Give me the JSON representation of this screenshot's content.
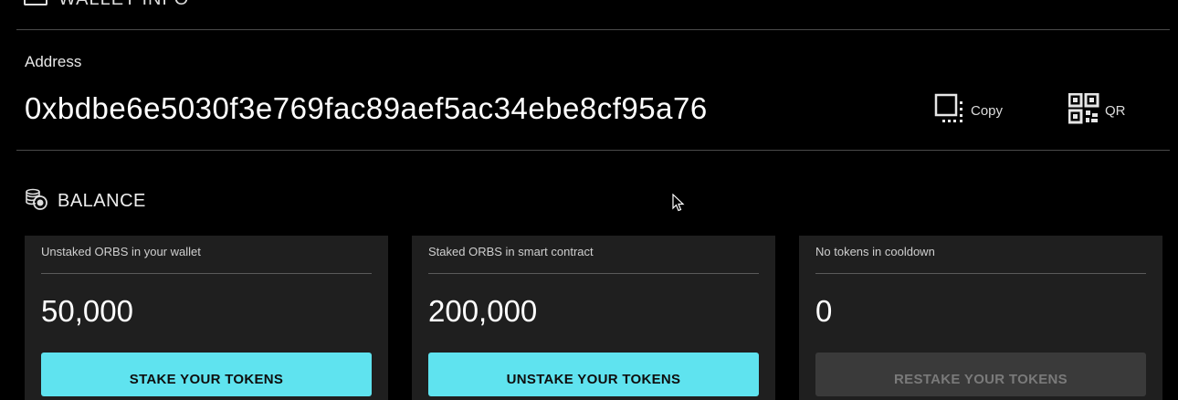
{
  "header": {
    "title": "WALLET INFO"
  },
  "address": {
    "label": "Address",
    "value": "0xbdbe6e5030f3e769fac89aef5ac34ebe8cf95a76",
    "copy_label": "Copy",
    "qr_label": "QR"
  },
  "balance": {
    "title": "BALANCE",
    "cards": [
      {
        "label": "Unstaked ORBS in your wallet",
        "value": "50,000",
        "button": "STAKE YOUR TOKENS",
        "enabled": true
      },
      {
        "label": "Staked ORBS in smart contract",
        "value": "200,000",
        "button": "UNSTAKE YOUR TOKENS",
        "enabled": true
      },
      {
        "label": "No tokens in cooldown",
        "value": "0",
        "button": "RESTAKE YOUR TOKENS",
        "enabled": false
      }
    ]
  },
  "colors": {
    "background": "#000000",
    "card": "#1f1f1f",
    "accent": "#5fe3ef",
    "disabled_button": "#3a3a3a"
  },
  "icons": [
    "wallet-icon",
    "copy-icon",
    "qr-code-icon",
    "coins-icon",
    "mouse-cursor-icon"
  ]
}
